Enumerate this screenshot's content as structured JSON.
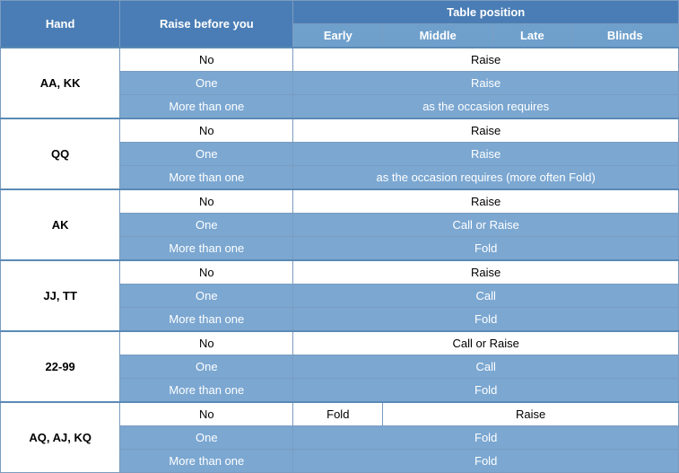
{
  "table": {
    "headers": {
      "hand": "Hand",
      "raise_before_you": "Raise before you",
      "table_position": "Table position",
      "early": "Early",
      "middle": "Middle",
      "late": "Late",
      "blinds": "Blinds"
    },
    "rows": [
      {
        "hand": "AA, KK",
        "sub_rows": [
          {
            "raise": "No",
            "action": "Raise",
            "action_type": "white",
            "colspan": 4,
            "raise_type": "white"
          },
          {
            "raise": "One",
            "action": "Raise",
            "action_type": "blue",
            "colspan": 4,
            "raise_type": "blue"
          },
          {
            "raise": "More than one",
            "action": "as the occasion requires",
            "action_type": "blue",
            "colspan": 4,
            "raise_type": "blue"
          }
        ]
      },
      {
        "hand": "QQ",
        "sub_rows": [
          {
            "raise": "No",
            "action": "Raise",
            "action_type": "white",
            "colspan": 4,
            "raise_type": "white"
          },
          {
            "raise": "One",
            "action": "Raise",
            "action_type": "blue",
            "colspan": 4,
            "raise_type": "blue"
          },
          {
            "raise": "More than one",
            "action": "as the occasion requires (more often Fold)",
            "action_type": "blue",
            "colspan": 4,
            "raise_type": "blue"
          }
        ]
      },
      {
        "hand": "AK",
        "sub_rows": [
          {
            "raise": "No",
            "action": "Raise",
            "action_type": "white",
            "colspan": 4,
            "raise_type": "white"
          },
          {
            "raise": "One",
            "action": "Call or Raise",
            "action_type": "blue",
            "colspan": 4,
            "raise_type": "blue"
          },
          {
            "raise": "More than one",
            "action": "Fold",
            "action_type": "blue",
            "colspan": 4,
            "raise_type": "blue"
          }
        ]
      },
      {
        "hand": "JJ, TT",
        "sub_rows": [
          {
            "raise": "No",
            "action": "Raise",
            "action_type": "white",
            "colspan": 4,
            "raise_type": "white"
          },
          {
            "raise": "One",
            "action": "Call",
            "action_type": "blue",
            "colspan": 4,
            "raise_type": "blue"
          },
          {
            "raise": "More than one",
            "action": "Fold",
            "action_type": "blue",
            "colspan": 4,
            "raise_type": "blue"
          }
        ]
      },
      {
        "hand": "22-99",
        "sub_rows": [
          {
            "raise": "No",
            "action": "Call or Raise",
            "action_type": "white",
            "colspan": 4,
            "raise_type": "white"
          },
          {
            "raise": "One",
            "action": "Call",
            "action_type": "blue",
            "colspan": 4,
            "raise_type": "blue"
          },
          {
            "raise": "More than one",
            "action": "Fold",
            "action_type": "blue",
            "colspan": 4,
            "raise_type": "blue"
          }
        ]
      },
      {
        "hand": "AQ, AJ, KQ",
        "sub_rows": [
          {
            "raise": "No",
            "action_split": true,
            "action_early": "Fold",
            "action_rest": "Raise",
            "action_type": "white",
            "raise_type": "white"
          },
          {
            "raise": "One",
            "action": "Fold",
            "action_type": "blue",
            "colspan": 4,
            "raise_type": "blue"
          },
          {
            "raise": "More than one",
            "action": "Fold",
            "action_type": "blue",
            "colspan": 4,
            "raise_type": "blue"
          }
        ]
      }
    ]
  }
}
